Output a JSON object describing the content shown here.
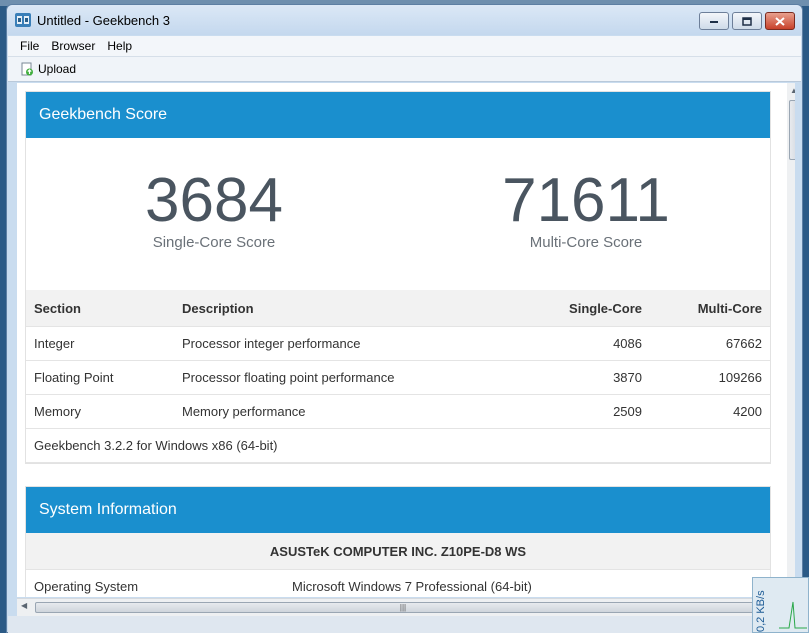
{
  "window": {
    "title": "Untitled - Geekbench 3"
  },
  "menu": {
    "items": [
      "File",
      "Browser",
      "Help"
    ]
  },
  "toolbar": {
    "upload_label": "Upload"
  },
  "score_card": {
    "header": "Geekbench Score",
    "single_core": {
      "value": "3684",
      "label": "Single-Core Score"
    },
    "multi_core": {
      "value": "71611",
      "label": "Multi-Core Score"
    }
  },
  "results_table": {
    "columns": [
      "Section",
      "Description",
      "Single-Core",
      "Multi-Core"
    ],
    "rows": [
      {
        "section": "Integer",
        "description": "Processor integer performance",
        "single": "4086",
        "multi": "67662"
      },
      {
        "section": "Floating Point",
        "description": "Processor floating point performance",
        "single": "3870",
        "multi": "109266"
      },
      {
        "section": "Memory",
        "description": "Memory performance",
        "single": "2509",
        "multi": "4200"
      }
    ],
    "footer": "Geekbench 3.2.2 for Windows x86 (64-bit)"
  },
  "system_card": {
    "header": "System Information",
    "model": "ASUSTeK COMPUTER INC. Z10PE-D8 WS",
    "rows": [
      {
        "key": "Operating System",
        "value": "Microsoft Windows 7 Professional (64-bit)"
      }
    ]
  },
  "net_widget": {
    "rate": "0,2 KB/s"
  },
  "colors": {
    "accent": "#1a8fce",
    "score_text": "#4a5560"
  }
}
